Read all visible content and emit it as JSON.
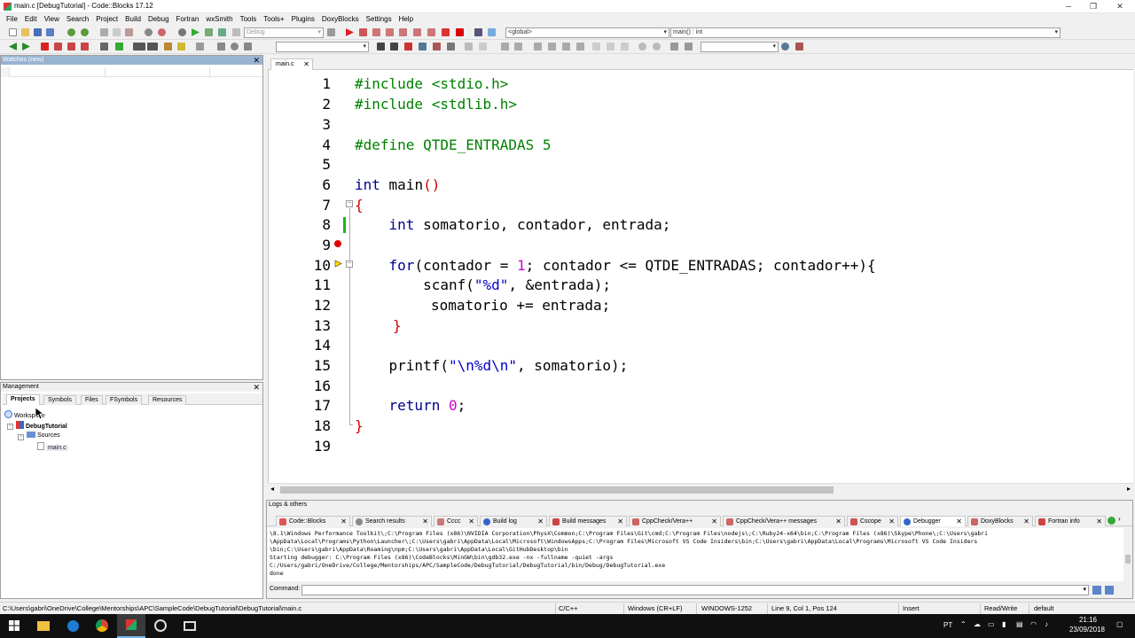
{
  "window": {
    "title": "main.c [DebugTutorial] - Code::Blocks 17.12",
    "minimize": "─",
    "maximize": "❐",
    "close": "✕"
  },
  "menu": [
    "File",
    "Edit",
    "View",
    "Search",
    "Project",
    "Build",
    "Debug",
    "Fortran",
    "wxSmith",
    "Tools",
    "Tools+",
    "Plugins",
    "DoxyBlocks",
    "Settings",
    "Help"
  ],
  "toolbar": {
    "build_target": "Debug",
    "scope": "<global>",
    "function": "main() : int"
  },
  "watches": {
    "title": "Watches (new)"
  },
  "management": {
    "title": "Management",
    "tabs": [
      "Projects",
      "Symbols",
      "Files",
      "FSymbols",
      "Resources"
    ],
    "tree": {
      "workspace": "Workspace",
      "project": "DebugTutorial",
      "folder": "Sources",
      "file": "main.c"
    }
  },
  "editor": {
    "tab_label": "main.c",
    "line_numbers": [
      "1",
      "2",
      "3",
      "4",
      "5",
      "6",
      "7",
      "8",
      "9",
      "10",
      "11",
      "12",
      "13",
      "14",
      "15",
      "16",
      "17",
      "18",
      "19"
    ],
    "code": {
      "l1": "#include <stdio.h>",
      "l2": "#include <stdlib.h>",
      "l4": "#define QTDE_ENTRADAS 5",
      "l6_kw": "int",
      "l6_rest": " main",
      "l6_paren": "()",
      "l7": "{",
      "l8_kw": "int",
      "l8_rest": " somatorio, contador, entrada;",
      "l10_kw": "for",
      "l10_a": "(contador = ",
      "l10_num": "1",
      "l10_b": "; contador <= QTDE_ENTRADAS; contador++){",
      "l11_a": "scanf(",
      "l11_str": "\"%d\"",
      "l11_b": ", &entrada);",
      "l12": "somatorio += entrada;",
      "l13": "}",
      "l15_a": "printf(",
      "l15_str": "\"\\n%d\\n\"",
      "l15_b": ", somatorio);",
      "l17_kw": "return",
      "l17_num": "0",
      "l17_semi": ";",
      "l18": "}"
    }
  },
  "logs": {
    "title": "Logs & others",
    "tabs": [
      "Code::Blocks",
      "Search results",
      "Cccc",
      "Build log",
      "Build messages",
      "CppCheck/Vera++",
      "CppCheck/Vera++ messages",
      "Cscope",
      "Debugger",
      "DoxyBlocks",
      "Fortran info"
    ],
    "active_tab": "Debugger",
    "lines": [
      "\\8.1\\Windows Performance Toolkit\\;C:\\Program Files (x86)\\NVIDIA Corporation\\PhysX\\Common;C:\\Program Files\\Git\\cmd;C:\\Program Files\\nodejs\\;C:\\Ruby24-x64\\bin;C:\\Program Files (x86)\\Skype\\Phone\\;C:\\Users\\gabri",
      "\\AppData\\Local\\Programs\\Python\\Launcher\\;C:\\Users\\gabri\\AppData\\Local\\Microsoft\\WindowsApps;C:\\Program Files\\Microsoft VS Code Insiders\\bin;C:\\Users\\gabri\\AppData\\Local\\Programs\\Microsoft VS Code Insiders",
      "\\bin;C:\\Users\\gabri\\AppData\\Roaming\\npm;C:\\Users\\gabri\\AppData\\Local\\GitHubDesktop\\bin",
      "Starting debugger: C:\\Program Files (x86)\\CodeBlocks\\MinGW\\bin\\gdb32.exe -nx -fullname -quiet  -args",
      "C:/Users/gabri/OneDrive/College/Mentorships/APC/SampleCode/DebugTutorial/DebugTutorial/bin/Debug/DebugTutorial.exe",
      "done"
    ],
    "command_label": "Command:"
  },
  "status": {
    "path": "C:\\Users\\gabri\\OneDrive\\College\\Mentorships\\APC\\SampleCode\\DebugTutorial\\DebugTutorial\\main.c",
    "language": "C/C++",
    "eol": "Windows (CR+LF)",
    "encoding": "WINDOWS-1252",
    "position": "Line 9, Col 1, Pos 124",
    "mode": "Insert",
    "access": "Read/Write",
    "theme": "default"
  },
  "taskbar": {
    "lang": "PT",
    "time": "21:16",
    "date": "23/09/2018"
  },
  "colors": {
    "preprocessor": "#008000",
    "keyword": "#00008b",
    "number": "#cc00cc",
    "string": "#0000cc",
    "operator": "#cc0000",
    "breakpoint": "#e00000",
    "changed_line": "#1db61d"
  }
}
